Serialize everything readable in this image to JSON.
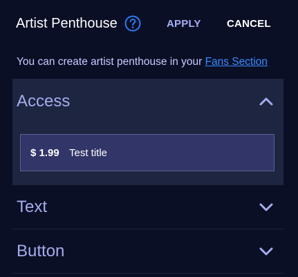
{
  "header": {
    "title": "Artist Penthouse",
    "apply_label": "APPLY",
    "cancel_label": "CANCEL"
  },
  "info": {
    "text": "You can create artist penthouse in your ",
    "link_text": "Fans Section"
  },
  "sections": [
    {
      "label": "Access",
      "expanded": true,
      "items": [
        {
          "price": "$ 1.99",
          "title": "Test title"
        }
      ]
    },
    {
      "label": "Text",
      "expanded": false
    },
    {
      "label": "Button",
      "expanded": false
    }
  ],
  "icons": {
    "help": "help-circle-icon",
    "expanded": "chevron-up-icon",
    "collapsed": "chevron-down-icon"
  },
  "colors": {
    "background": "#0a0f26",
    "accent_blue": "#2f7cf0",
    "apply": "#a6b0f5",
    "section_label": "#a6acec",
    "expanded_section_bg": "#1d2540",
    "card_bg": "#323568"
  }
}
